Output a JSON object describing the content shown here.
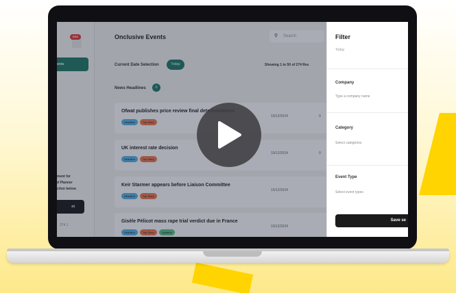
{
  "sidebar": {
    "logo_badge": "RSS",
    "active_nav_label": "Events",
    "nav_item_2": "",
    "promo_text": "ment for\nd Planner\nction below.",
    "promo_button_label": "nt",
    "version": "274.1"
  },
  "header": {
    "title": "Onclusive Events",
    "search_placeholder": "Search"
  },
  "toolbar": {
    "date_label": "Current Date Selection",
    "date_value": "Today",
    "showing": "Showing 1 to 50 of 274 Res",
    "headlines_label": "News Headlines",
    "headlines_count": "0"
  },
  "rows": [
    {
      "title": "Ofwat publishes price review final determinations",
      "date": "19/12/2024",
      "extra": "0",
      "tags": [
        "Headline",
        "Top Story"
      ]
    },
    {
      "title": "UK interest rate decision",
      "date": "19/12/2024",
      "extra": "0",
      "tags": [
        "Headline",
        "Top Story"
      ]
    },
    {
      "title": "Keir Starmer appears before Liaison Committee",
      "date": "19/12/2024",
      "extra": "",
      "tags": [
        "Headline",
        "Top Story"
      ]
    },
    {
      "title": "Gisèle Pélicot mass rape trial verdict due in France",
      "date": "19/12/2024",
      "extra": "",
      "tags": [
        "Headline",
        "Top Story",
        "Updated"
      ]
    }
  ],
  "filter": {
    "title": "Filter",
    "cut_field": "Today",
    "company_label": "Company",
    "company_placeholder": "Type a company name",
    "category_label": "Category",
    "category_placeholder": "Select categories",
    "event_type_label": "Event Type",
    "event_type_placeholder": "Select event types",
    "save_label": "Save se"
  },
  "colors": {
    "accent_green": "#1f7a66",
    "tag_headline": "#5ab4e6",
    "tag_topstory": "#f07a52",
    "tag_updated": "#5cc48a",
    "brand_yellow": "#ffd400"
  },
  "icons": {
    "play": "play-icon",
    "search": "search-icon"
  }
}
